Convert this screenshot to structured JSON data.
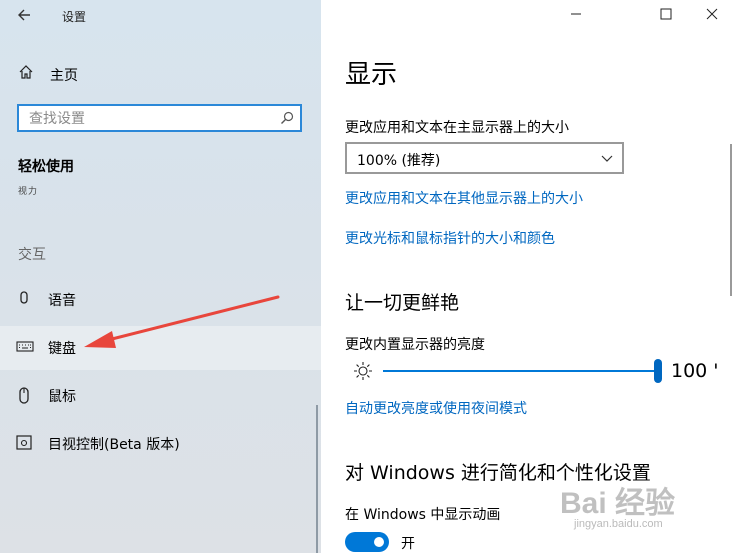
{
  "app": {
    "title": "设置"
  },
  "sidebar": {
    "home_label": "主页",
    "search_placeholder": "查找设置",
    "section_title": "轻松使用",
    "section_subtitle": "视力",
    "group_label": "交互",
    "items": [
      {
        "label": "语音",
        "icon": "microphone-icon"
      },
      {
        "label": "键盘",
        "icon": "keyboard-icon",
        "selected": true
      },
      {
        "label": "鼠标",
        "icon": "mouse-icon"
      },
      {
        "label": "目视控制(Beta 版本)",
        "icon": "eye-control-icon"
      }
    ]
  },
  "window_controls": {
    "minimize": "—",
    "maximize": "☐",
    "close": "✕"
  },
  "main": {
    "title": "显示",
    "size_label": "更改应用和文本在主显示器上的大小",
    "size_value": "100% (推荐)",
    "link_other_displays": "更改应用和文本在其他显示器上的大小",
    "link_cursor": "更改光标和鼠标指针的大小和颜色",
    "brightness_heading": "让一切更鲜艳",
    "brightness_label": "更改内置显示器的亮度",
    "brightness_value": "100",
    "brightness_value_display": "100 '",
    "link_auto_brightness": "自动更改亮度或使用夜间模式",
    "simplify_heading": "对 Windows 进行简化和个性化设置",
    "animation_label": "在 Windows 中显示动画",
    "animation_toggle": "开"
  },
  "watermark": {
    "brand": "Bai 经验",
    "url": "jingyan.baidu.com"
  },
  "colors": {
    "accent": "#0078d7",
    "link": "#0067c0",
    "annotation_arrow": "#e8463c"
  }
}
